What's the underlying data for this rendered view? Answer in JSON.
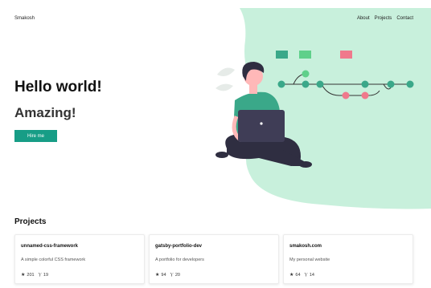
{
  "header": {
    "brand": "Smakosh",
    "nav": [
      "About",
      "Projects",
      "Contact"
    ]
  },
  "hero": {
    "title": "Hello world!",
    "subtitle": "Amazing!",
    "cta_label": "Hire me"
  },
  "projects": {
    "title": "Projects",
    "items": [
      {
        "name": "unnamed-css-framework",
        "description": "A simple colorful CSS framework",
        "stars": "201",
        "forks": "19"
      },
      {
        "name": "gatsby-portfolio-dev",
        "description": "A portfolio for developers",
        "stars": "94",
        "forks": "20"
      },
      {
        "name": "smakosh.com",
        "description": "My personal website",
        "stars": "64",
        "forks": "14"
      }
    ]
  },
  "colors": {
    "accent": "#179d86",
    "blob": "#c8f0dc",
    "node_green": "#3aa889",
    "node_pink": "#f0798c"
  },
  "icons": [
    "star-icon",
    "fork-icon"
  ]
}
